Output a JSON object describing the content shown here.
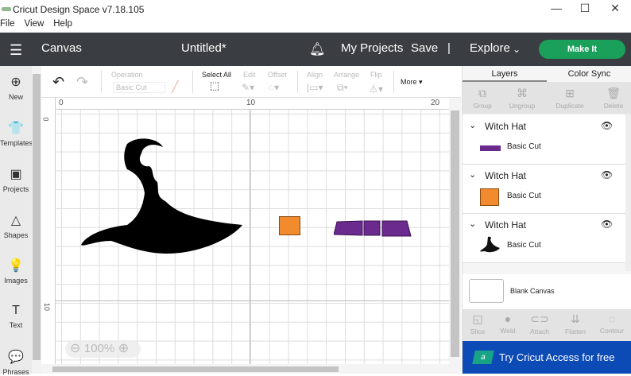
{
  "window": {
    "title": "Cricut Design Space  v7.18.105",
    "minimize": "—",
    "maximize": "☐",
    "close": "✕"
  },
  "menu": [
    "File",
    "View",
    "Help"
  ],
  "header": {
    "canvas": "Canvas",
    "title": "Untitled*",
    "my_projects": "My Projects",
    "save": "Save",
    "divider": "|",
    "explore": "Explore",
    "make_it": "Make It"
  },
  "leftbar": [
    {
      "label": "New",
      "icon": "⊕"
    },
    {
      "label": "Templates",
      "icon": "👕"
    },
    {
      "label": "Projects",
      "icon": "▣"
    },
    {
      "label": "Shapes",
      "icon": "△"
    },
    {
      "label": "Images",
      "icon": "💡"
    },
    {
      "label": "Text",
      "icon": "T"
    },
    {
      "label": "Phrases",
      "icon": "💬"
    }
  ],
  "toolbar": {
    "operation_label": "Operation",
    "operation_value": "Basic Cut",
    "select_all": "Select All",
    "edit": "Edit",
    "offset": "Offset",
    "align": "Align",
    "arrange": "Arrange",
    "flip": "Flip",
    "more": "More ▾"
  },
  "ruler": {
    "top": [
      "0",
      "10",
      "20"
    ],
    "left": [
      "0",
      "10"
    ]
  },
  "zoom": {
    "minus": "⊖",
    "value": "100%",
    "plus": "⊕"
  },
  "panel": {
    "tabs": [
      "Layers",
      "Color Sync"
    ],
    "tools": [
      "Group",
      "Ungroup",
      "Duplicate",
      "Delete"
    ],
    "layers": [
      {
        "name": "Witch Hat",
        "op": "Basic Cut",
        "color": "#6a2a8e"
      },
      {
        "name": "Witch Hat",
        "op": "Basic Cut",
        "color": "#f28a2e"
      },
      {
        "name": "Witch Hat",
        "op": "Basic Cut",
        "color": "#111111"
      }
    ],
    "blank_canvas": "Blank Canvas",
    "bottom_tools": [
      "Slice",
      "Weld",
      "Attach",
      "Flatten",
      "Contour"
    ],
    "access": "Try Cricut Access for free",
    "access_badge": "a"
  }
}
